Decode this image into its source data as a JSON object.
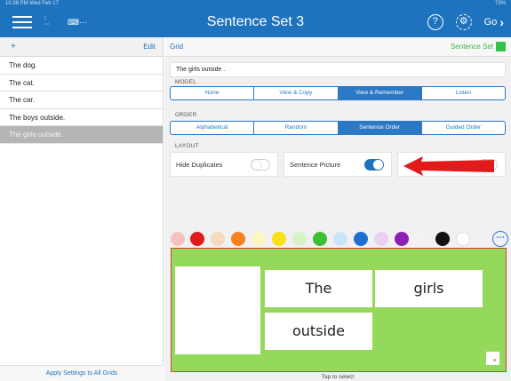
{
  "status": {
    "time": "10:38 PM  Wed Feb 17",
    "battery": "73%"
  },
  "header": {
    "title": "Sentence Set 3",
    "go_label": "Go"
  },
  "sidebar": {
    "add_label": "+",
    "edit_label": "Edit",
    "items": [
      {
        "label": "The dog.",
        "selected": false
      },
      {
        "label": "The cat.",
        "selected": false
      },
      {
        "label": "The car.",
        "selected": false
      },
      {
        "label": "The boys outside.",
        "selected": false
      },
      {
        "label": "The girls outside.",
        "selected": true
      }
    ],
    "footer": "Apply Settings to All Grids"
  },
  "main": {
    "grid_label": "Grid",
    "set_label": "Sentence Set",
    "set_color": "#35c24a",
    "sentence": "The girls outside .",
    "model": {
      "label": "MODEL",
      "options": [
        "None",
        "View & Copy",
        "View & Remember",
        "Listen"
      ],
      "selected": "View & Remember"
    },
    "order": {
      "label": "ORDER",
      "options": [
        "Alphabetical",
        "Random",
        "Sentence Order",
        "Guided Order"
      ],
      "selected": "Sentence Order"
    },
    "layout": {
      "label": "LAYOUT",
      "hide_duplicates": {
        "label": "Hide Duplicates",
        "on": false
      },
      "sentence_picture": {
        "label": "Sentence Picture",
        "on": true
      },
      "third_toggle": {
        "on": false
      }
    },
    "palette": [
      "#f7c1c1",
      "#e11b1b",
      "#f7d9bd",
      "#f5821f",
      "#fdf6c0",
      "#f7e214",
      "#d8f2c7",
      "#3cbf35",
      "#c8e6f8",
      "#1f6fd1",
      "#ead1f2",
      "#8b1fb8",
      "#f2f2f2",
      "#111111",
      "#ffffff"
    ],
    "preview_bg": "#94d85c",
    "cards": [
      "The",
      "girls",
      "outside"
    ],
    "tap_label": "Tap to select"
  },
  "accent": "#1e73be",
  "annotation_color": "#e11b1b"
}
